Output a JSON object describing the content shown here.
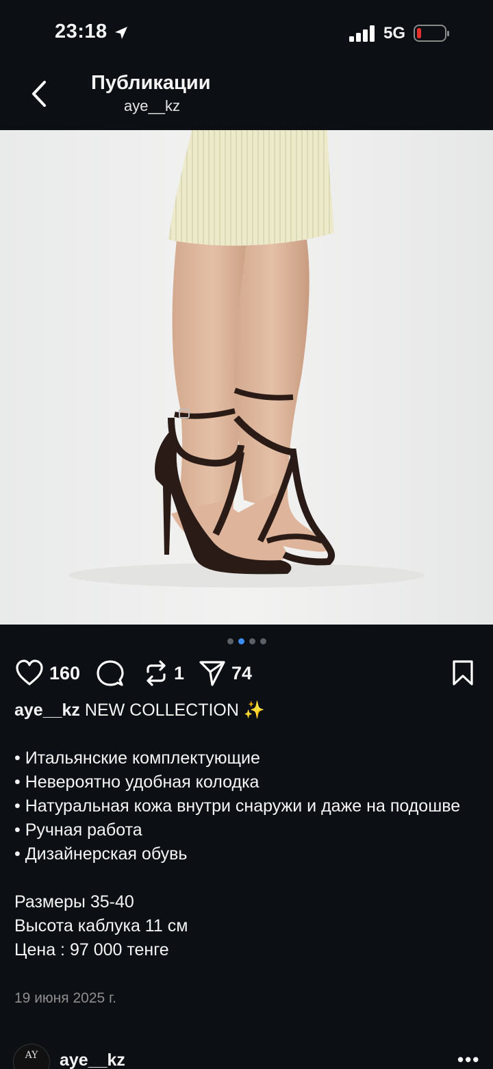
{
  "status_bar": {
    "time": "23:18",
    "network": "5G",
    "icons": [
      "location-arrow-icon",
      "signal-icon",
      "battery-low-icon"
    ],
    "battery_color": "#e5302c"
  },
  "header": {
    "title": "Публикации",
    "username": "aye__kz",
    "back_icon": "chevron-left-icon"
  },
  "carousel": {
    "total": 4,
    "active_index": 1,
    "active_color": "#3e8bf2"
  },
  "actions": {
    "likes": "160",
    "reposts": "1",
    "shares": "74",
    "icons": [
      "heart-icon",
      "comment-icon",
      "repost-icon",
      "send-icon",
      "bookmark-icon"
    ]
  },
  "caption": {
    "username": "aye__kz",
    "headline": "NEW COLLECTION ✨",
    "bullets": [
      "• Итальянские комплектующие",
      "• Невероятно удобная колодка",
      "• Натуральная кожа внутри снаружи и даже на подошве",
      "• Ручная работа",
      "• Дизайнерская обувь"
    ],
    "details": [
      "Размеры 35-40",
      "Высота каблука 11 см",
      "Цена : 97 000 тенге"
    ],
    "date": "19 июня 2025 г."
  },
  "next_post": {
    "username": "aye__kz",
    "avatar_text": "AY"
  }
}
